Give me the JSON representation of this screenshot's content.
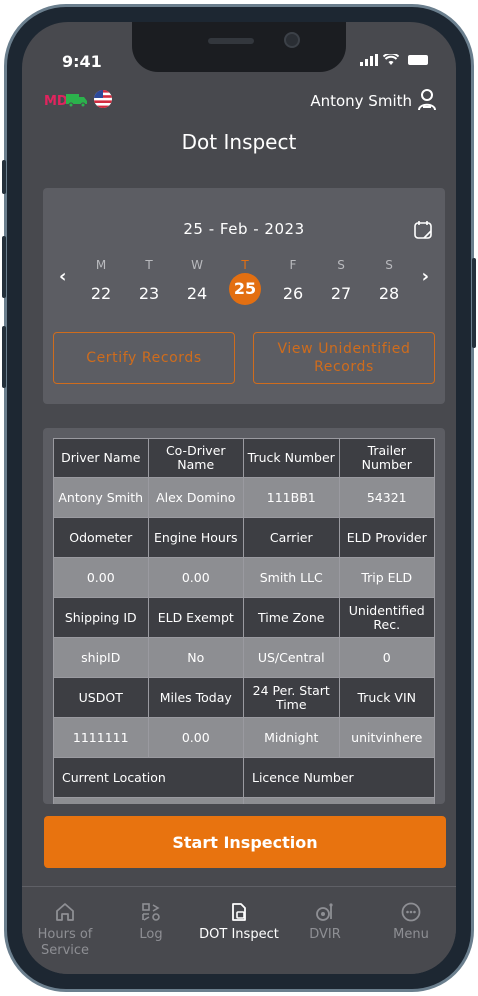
{
  "status_bar": {
    "time": "9:41"
  },
  "header": {
    "state": "MD",
    "user_name": "Antony Smith",
    "title": "Dot Inspect"
  },
  "date_picker": {
    "selected_date": "25 - Feb - 2023",
    "days": [
      {
        "name": "M",
        "num": "22"
      },
      {
        "name": "T",
        "num": "23"
      },
      {
        "name": "W",
        "num": "24"
      },
      {
        "name": "T",
        "num": "25"
      },
      {
        "name": "F",
        "num": "26"
      },
      {
        "name": "S",
        "num": "27"
      },
      {
        "name": "S",
        "num": "28"
      }
    ],
    "prev": "‹",
    "next": "›"
  },
  "actions": {
    "certify_label": "Certify Records",
    "view_unidentified_label": "View Unidentified Records"
  },
  "info_table": {
    "rows": [
      [
        "Driver Name",
        "Co-Driver Name",
        "Truck Number",
        "Trailer Number"
      ],
      [
        "Antony Smith",
        "Alex Domino",
        "111BB1",
        "54321"
      ],
      [
        "Odometer",
        "Engine Hours",
        "Carrier",
        "ELD Provider"
      ],
      [
        "0.00",
        "0.00",
        "Smith LLC",
        "Trip ELD"
      ],
      [
        "Shipping ID",
        "ELD Exempt",
        "Time Zone",
        "Unidentified Rec."
      ],
      [
        "shipID",
        "No",
        "US/Central",
        "0"
      ],
      [
        "USDOT",
        "Miles Today",
        "24 Per. Start Time",
        "Truck VIN"
      ],
      [
        "1111111",
        "0.00",
        "Midnight",
        "unitvinhere"
      ],
      [
        "Current Location",
        "Licence Number"
      ]
    ]
  },
  "start_button": "Start Inspection",
  "bottom_nav": [
    {
      "label": "Hours of Service",
      "icon": "home-icon"
    },
    {
      "label": "Log",
      "icon": "log-icon"
    },
    {
      "label": "DOT Inspect",
      "icon": "dot-inspect-icon"
    },
    {
      "label": "DVIR",
      "icon": "dvir-icon"
    },
    {
      "label": "Menu",
      "icon": "menu-icon"
    }
  ],
  "colors": {
    "accent": "#e8730f",
    "background": "#48494e",
    "card": "#5c5d63"
  }
}
